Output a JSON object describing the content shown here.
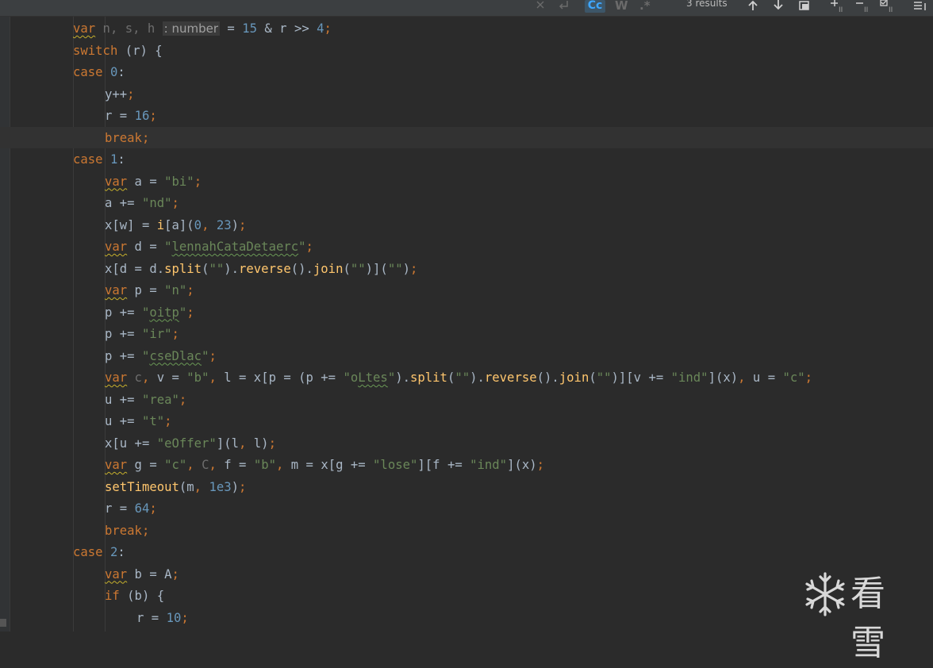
{
  "toolbar": {
    "match_case_label": "Cc",
    "words_label": "W",
    "regex_label": ".*",
    "results": "3 results",
    "icons": [
      "close-icon",
      "newline-icon",
      "arrow-up-icon",
      "arrow-down-icon",
      "select-all-icon",
      "filter-icon",
      "filter-icon",
      "filter-icon",
      "settings-icon"
    ]
  },
  "code": {
    "l1": {
      "var": "var",
      "vars": " n, s, h ",
      "hint": ": number",
      "rest": " = ",
      "n15": "15",
      "amp": " & r >> ",
      "n4": "4",
      "semi": ";"
    },
    "l2": {
      "kw": "switch",
      "rest": " (r) {"
    },
    "l3": {
      "kw": "case",
      "sp": " ",
      "num": "0",
      "rest": ":"
    },
    "l4": {
      "rest": "y++",
      "semi": ";"
    },
    "l5": {
      "rest": "r = ",
      "num": "16",
      "semi": ";"
    },
    "l6": {
      "kw": "break",
      "semi": ";"
    },
    "l7": {
      "kw": "case",
      "sp": " ",
      "num": "1",
      "rest": ":"
    },
    "l8": {
      "var": "var",
      "rest": " a = ",
      "str": "\"bi\"",
      "semi": ";"
    },
    "l9": {
      "rest": "a += ",
      "str": "\"nd\"",
      "semi": ";"
    },
    "l10": {
      "a": "x[w] = ",
      "fn": "i",
      "b": "[a](",
      "n0": "0",
      "c": ", ",
      "n23": "23",
      "d": ")",
      "semi": ";"
    },
    "l11": {
      "var": "var",
      "rest": " d = ",
      "q1": "\"",
      "str": "lennahCataDetaerc",
      "q2": "\"",
      "semi": ";"
    },
    "l12": {
      "a": "x[d = d.",
      "split": "split",
      "b": "(",
      "s1": "\"\"",
      "c": ").",
      "reverse": "reverse",
      "d": "().",
      "join": "join",
      "e": "(",
      "s2": "\"\"",
      "f": ")](",
      "s3": "\"\"",
      "g": ")",
      "semi": ";"
    },
    "l13": {
      "var": "var",
      "rest": " p = ",
      "str": "\"n\"",
      "semi": ";"
    },
    "l14": {
      "rest": "p += ",
      "q1": "\"",
      "str": "oitp",
      "q2": "\"",
      "semi": ";"
    },
    "l15": {
      "rest": "p += ",
      "str": "\"ir\"",
      "semi": ";"
    },
    "l16": {
      "rest": "p += ",
      "q1": "\"",
      "str": "cseDlac",
      "q2": "\"",
      "semi": ";"
    },
    "l17": {
      "var": "var",
      "c": " c",
      "comma1": ",",
      "a": " v = ",
      "s1": "\"b\"",
      "comma2": ",",
      "b": " l = x[p = (p += ",
      "q1": "\"o",
      "s2": "Ltes",
      "q2": "\"",
      "d": ").",
      "split": "split",
      "e": "(",
      "s3": "\"\"",
      "f": ").",
      "reverse": "reverse",
      "g": "().",
      "join": "join",
      "h": "(",
      "s4": "\"\"",
      "i": ")][v += ",
      "s5": "\"ind\"",
      "j": "](x)",
      "comma3": ",",
      "k": " u = ",
      "s6": "\"c\"",
      "semi": ";"
    },
    "l18": {
      "rest": "u += ",
      "str": "\"rea\"",
      "semi": ";"
    },
    "l19": {
      "rest": "u += ",
      "str": "\"t\"",
      "semi": ";"
    },
    "l20": {
      "a": "x[u += ",
      "str": "\"eOffer\"",
      "b": "](l",
      "comma": ",",
      "c": " l)",
      "semi": ";"
    },
    "l21": {
      "var": "var",
      "a": " g = ",
      "s1": "\"c\"",
      "comma1": ",",
      "C": " C",
      "comma2": ",",
      "b": " f = ",
      "s2": "\"b\"",
      "comma3": ",",
      "c": " m = x[g += ",
      "s3": "\"lose\"",
      "d": "][f += ",
      "s4": "\"ind\"",
      "e": "](x)",
      "semi": ";"
    },
    "l22": {
      "fn": "setTimeout",
      "a": "(m",
      "comma": ",",
      "sp": " ",
      "num": "1e3",
      "b": ")",
      "semi": ";"
    },
    "l23": {
      "rest": "r = ",
      "num": "64",
      "semi": ";"
    },
    "l24": {
      "kw": "break",
      "semi": ";"
    },
    "l25": {
      "kw": "case",
      "sp": " ",
      "num": "2",
      "rest": ":"
    },
    "l26": {
      "var": "var",
      "rest": " b = A",
      "semi": ";"
    },
    "l27": {
      "kw": "if",
      "rest": " (b) {"
    },
    "l28": {
      "rest": "r = ",
      "num": "10",
      "semi": ";"
    }
  },
  "watermark": {
    "text": "看雪",
    "icon": "snowflake-icon"
  }
}
